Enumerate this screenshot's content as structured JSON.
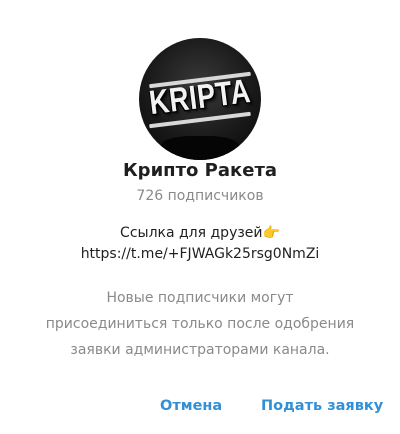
{
  "channel": {
    "avatar_logo_text": "KRIPTA",
    "title": "Крипто Ракета",
    "subscribers": "726 подписчиков"
  },
  "description": {
    "line1": "Ссылка для друзей👉",
    "line2": "https://t.me/+FJWAGk25rsg0NmZi"
  },
  "notice": {
    "line1": "Новые подписчики могут",
    "line2": "присоединиться только после одобрения",
    "line3": "заявки администраторами канала."
  },
  "actions": {
    "cancel_label": "Отмена",
    "apply_label": "Подать заявку"
  },
  "colors": {
    "accent": "#3390d6",
    "muted_text": "#8a8a8a",
    "primary_text": "#1f1f1f"
  }
}
